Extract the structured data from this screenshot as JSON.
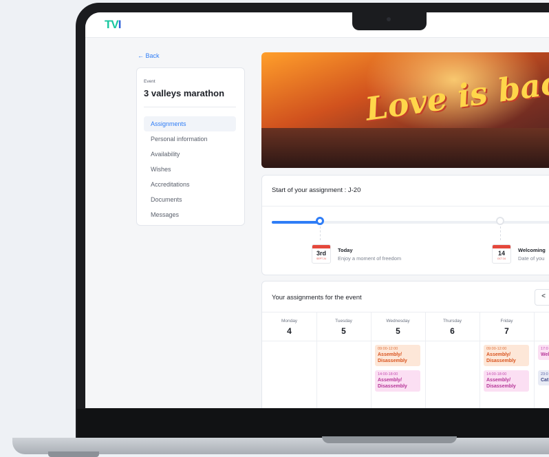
{
  "app": {
    "logo_text_a": "TV",
    "logo_text_b": "I"
  },
  "sidebar": {
    "back_label": "← Back",
    "event_label": "Event",
    "event_name": "3 valleys marathon",
    "items": [
      {
        "label": "Assignments",
        "active": true
      },
      {
        "label": "Personal information",
        "active": false
      },
      {
        "label": "Availability",
        "active": false
      },
      {
        "label": "Wishes",
        "active": false
      },
      {
        "label": "Accreditations",
        "active": false
      },
      {
        "label": "Documents",
        "active": false
      },
      {
        "label": "Messages",
        "active": false
      }
    ]
  },
  "hero": {
    "text": "Love is back"
  },
  "assignment_start": {
    "title": "Start of your assignment : J-20",
    "progress_fraction": 0.16,
    "milestones": [
      {
        "day": "3rd",
        "month": "SEPT 24",
        "title": "Today",
        "subtitle": "Enjoy a moment of freedom"
      },
      {
        "day": "14",
        "month": "OCT 24",
        "title": "Welcoming",
        "subtitle": "Date of you"
      }
    ]
  },
  "schedule": {
    "title": "Your assignments for the event",
    "prev_icon": "chevron-left-icon",
    "prev_label": "<",
    "days": [
      {
        "name": "Monday",
        "num": "4",
        "slots": []
      },
      {
        "name": "Tuesday",
        "num": "5",
        "slots": []
      },
      {
        "name": "Wednesday",
        "num": "5",
        "slots": [
          {
            "time": "09:00-12:00",
            "label": "Assembly/ Disassembly",
            "color": "orange"
          },
          {
            "time": "14:00-18:00",
            "label": "Assembly/ Disassembly",
            "color": "pink"
          }
        ]
      },
      {
        "name": "Thursday",
        "num": "6",
        "slots": []
      },
      {
        "name": "Friday",
        "num": "7",
        "slots": [
          {
            "time": "09:00-12:00",
            "label": "Assembly/ Disassembly",
            "color": "orange"
          },
          {
            "time": "14:00-18:00",
            "label": "Assembly/ Disassembly",
            "color": "pink"
          }
        ]
      },
      {
        "name": "",
        "num": "",
        "slots": [
          {
            "time": "17:0",
            "label": "Wel par",
            "color": "pink"
          },
          {
            "time": "23:0",
            "label": "Cat",
            "color": "gray"
          }
        ]
      }
    ]
  },
  "colors": {
    "accent": "#2f7df6",
    "calendar_red": "#e5483c"
  }
}
